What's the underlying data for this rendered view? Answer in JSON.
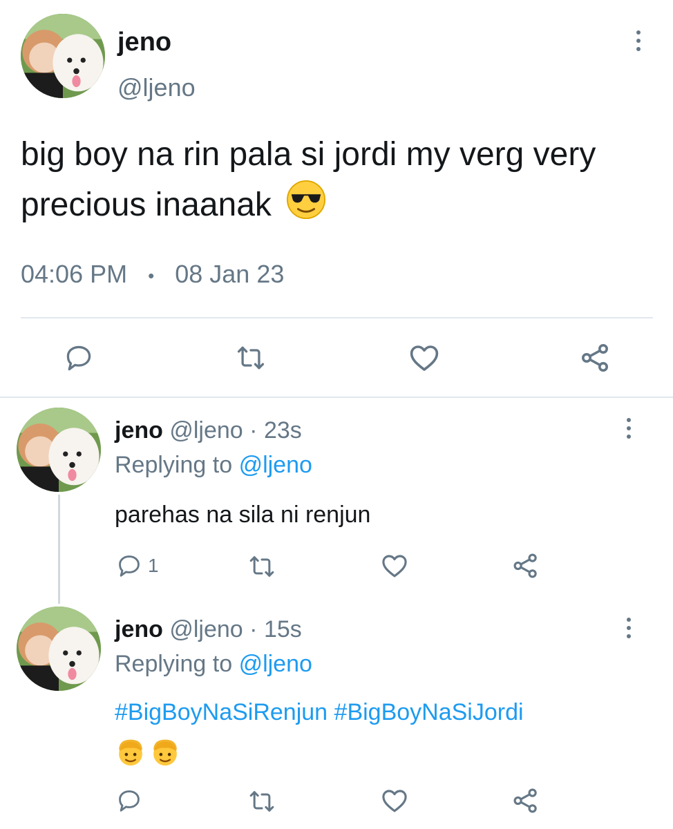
{
  "main_tweet": {
    "display_name": "jeno",
    "handle": "@ljeno",
    "text": "big boy na rin pala si jordi my verg very precious inaanak",
    "text_emoji": "smiling-face-with-sunglasses",
    "time": "04:06 PM",
    "separator": "•",
    "date": "08 Jan 23"
  },
  "replies": [
    {
      "display_name": "jeno",
      "handle": "@ljeno",
      "dot": "·",
      "time_ago": "23s",
      "replying_prefix": "Replying to",
      "replying_handle": "@ljeno",
      "text": "parehas na sila ni renjun",
      "reply_count": "1"
    },
    {
      "display_name": "jeno",
      "handle": "@ljeno",
      "dot": "·",
      "time_ago": "15s",
      "replying_prefix": "Replying to",
      "replying_handle": "@ljeno",
      "hashtag_1": "#BigBoyNaSiRenjun",
      "hashtag_2": "#BigBoyNaSiJordi",
      "emojis": [
        "boy-face",
        "boy-face"
      ],
      "reply_count": ""
    }
  ],
  "colors": {
    "link": "#1d9bf0",
    "muted": "#657786",
    "divider": "#e1e8ed"
  }
}
